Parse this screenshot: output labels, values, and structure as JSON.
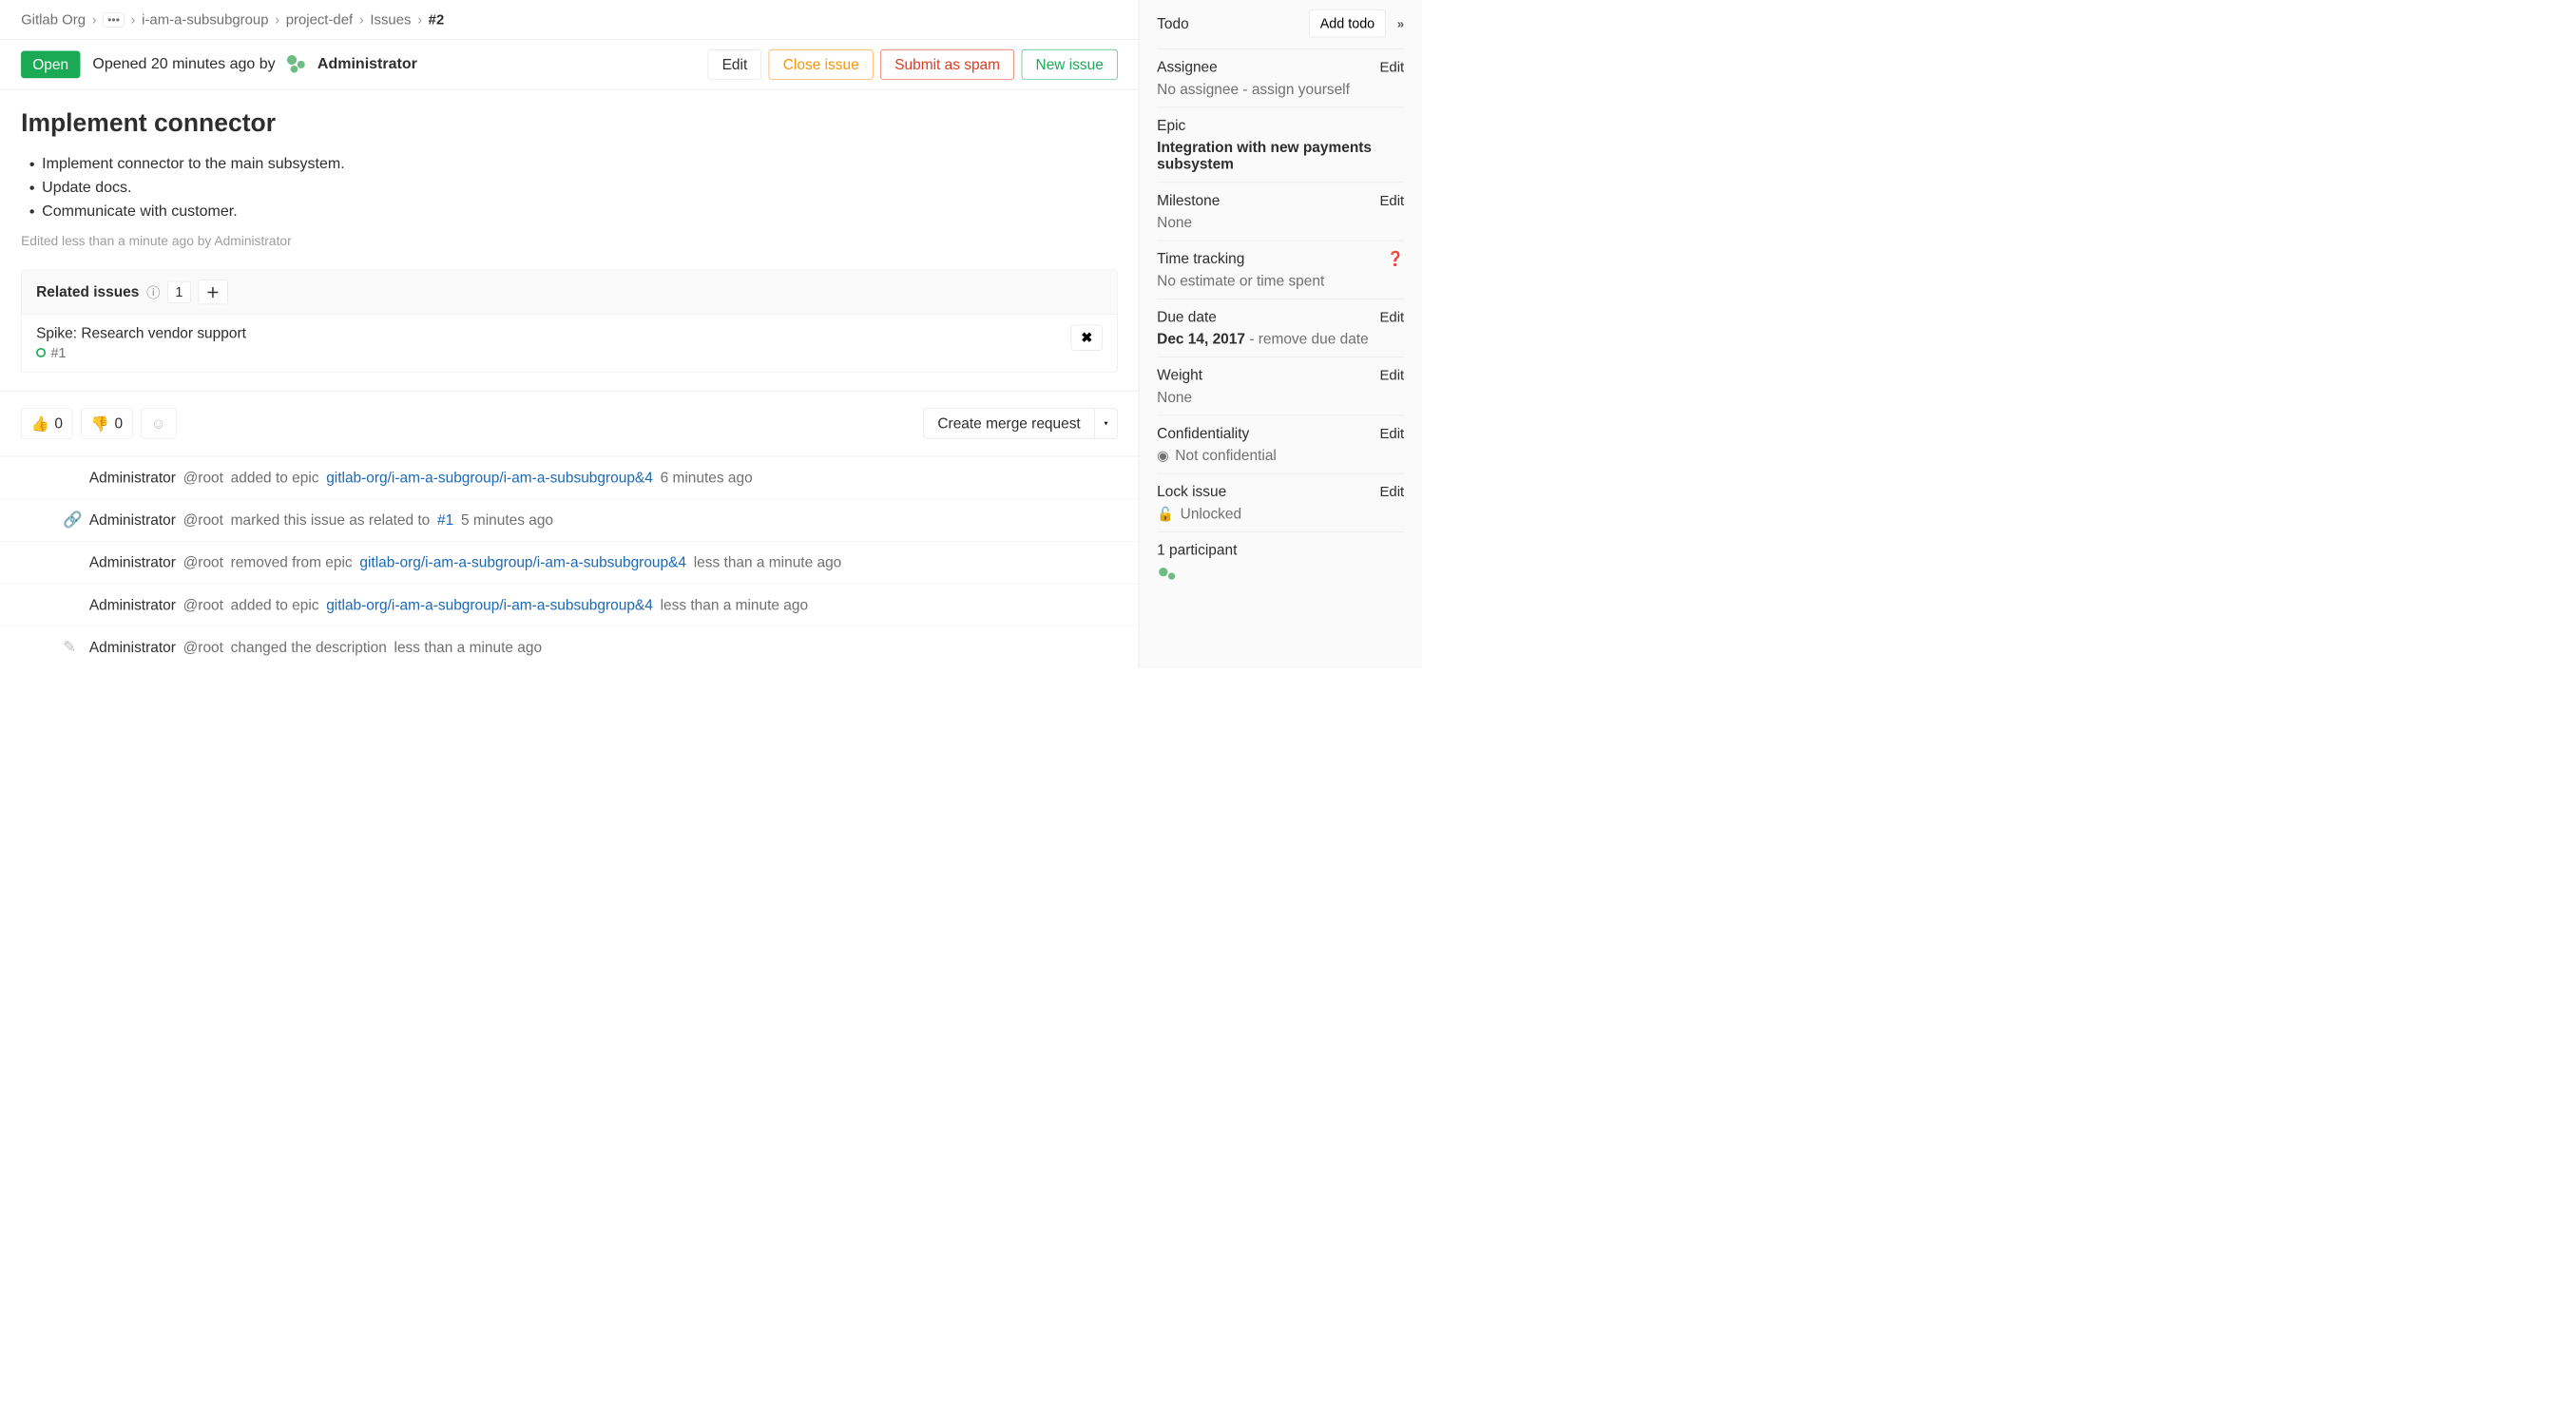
{
  "breadcrumbs": {
    "org": "Gitlab Org",
    "subgroup": "i-am-a-subsubgroup",
    "project": "project-def",
    "section": "Issues",
    "current": "#2"
  },
  "status": "Open",
  "opened_text": "Opened 20 minutes ago by",
  "author": "Administrator",
  "buttons": {
    "edit": "Edit",
    "close": "Close issue",
    "spam": "Submit as spam",
    "new": "New issue"
  },
  "title": "Implement connector",
  "description": [
    "Implement connector to the main subsystem.",
    "Update docs.",
    "Communicate with customer."
  ],
  "edited_note": "Edited less than a minute ago by Administrator",
  "related": {
    "label": "Related issues",
    "count": "1",
    "item": {
      "title": "Spike: Research vendor support",
      "ref": "#1"
    }
  },
  "reactions": {
    "up": "0",
    "down": "0"
  },
  "create_mr": "Create merge request",
  "activity": [
    {
      "who": "Administrator",
      "handle": "@root",
      "action": "added to epic",
      "link": "gitlab-org/i-am-a-subgroup/i-am-a-subsubgroup&4",
      "time": "6 minutes ago",
      "icon": ""
    },
    {
      "who": "Administrator",
      "handle": "@root",
      "action": "marked this issue as related to",
      "link": "#1",
      "time": "5 minutes ago",
      "icon": "link"
    },
    {
      "who": "Administrator",
      "handle": "@root",
      "action": "removed from epic",
      "link": "gitlab-org/i-am-a-subgroup/i-am-a-subsubgroup&4",
      "time": "less than a minute ago",
      "icon": ""
    },
    {
      "who": "Administrator",
      "handle": "@root",
      "action": "added to epic",
      "link": "gitlab-org/i-am-a-subgroup/i-am-a-subsubgroup&4",
      "time": "less than a minute ago",
      "icon": ""
    },
    {
      "who": "Administrator",
      "handle": "@root",
      "action": "changed the description",
      "link": "",
      "time": "less than a minute ago",
      "icon": "pencil"
    }
  ],
  "sidebar": {
    "todo_label": "Todo",
    "add_todo": "Add todo",
    "assignee": {
      "label": "Assignee",
      "edit": "Edit",
      "value": "No assignee - assign yourself"
    },
    "epic": {
      "label": "Epic",
      "value": "Integration with new payments subsystem"
    },
    "milestone": {
      "label": "Milestone",
      "edit": "Edit",
      "value": "None"
    },
    "time_tracking": {
      "label": "Time tracking",
      "value": "No estimate or time spent"
    },
    "due_date": {
      "label": "Due date",
      "edit": "Edit",
      "value": "Dec 14, 2017",
      "suffix": " - remove due date"
    },
    "weight": {
      "label": "Weight",
      "edit": "Edit",
      "value": "None"
    },
    "confidentiality": {
      "label": "Confidentiality",
      "edit": "Edit",
      "value": "Not confidential"
    },
    "lock": {
      "label": "Lock issue",
      "edit": "Edit",
      "value": "Unlocked"
    },
    "participants": {
      "label": "1 participant"
    }
  }
}
